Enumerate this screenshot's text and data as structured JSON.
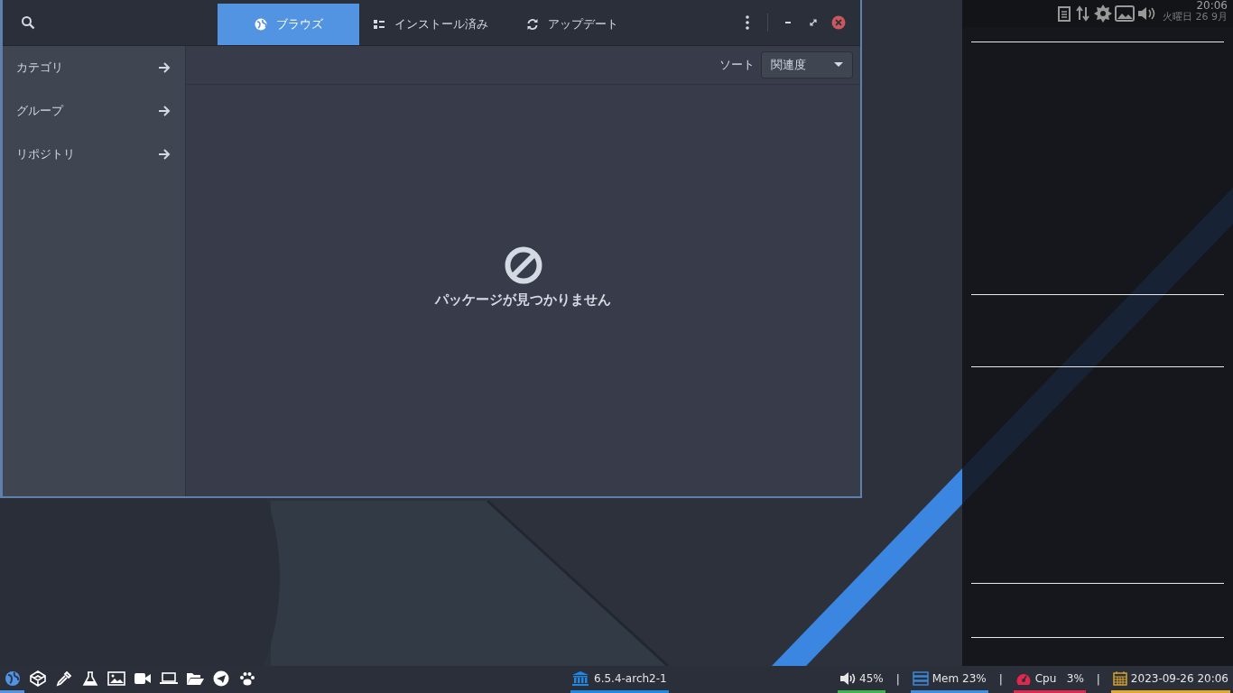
{
  "window": {
    "tabs": [
      {
        "label": "ブラウズ",
        "kind": "globe",
        "selected": true
      },
      {
        "label": "インストール済み",
        "kind": "list",
        "selected": false
      },
      {
        "label": "アップデート",
        "kind": "refresh",
        "selected": false
      }
    ],
    "sidebar": {
      "items": [
        {
          "label": "カテゴリ"
        },
        {
          "label": "グループ"
        },
        {
          "label": "リポジトリ"
        }
      ]
    },
    "sort": {
      "label": "ソート",
      "value": "関連度"
    },
    "empty_state": {
      "message": "パッケージが見つかりません"
    }
  },
  "side_panel": {
    "clock": {
      "time": "20:06",
      "date": "火曜日 26 9月"
    }
  },
  "taskbar": {
    "launchers": [
      {
        "kind": "globe",
        "selected": true
      },
      {
        "kind": "cube",
        "selected": false
      },
      {
        "kind": "dropper",
        "selected": false
      },
      {
        "kind": "flask",
        "selected": false
      },
      {
        "kind": "image",
        "selected": false
      },
      {
        "kind": "camera",
        "selected": false
      },
      {
        "kind": "laptop",
        "selected": false
      },
      {
        "kind": "folder",
        "selected": false
      },
      {
        "kind": "send",
        "selected": false
      },
      {
        "kind": "paw",
        "selected": false
      }
    ],
    "kernel": {
      "text": "6.5.4-arch2-1",
      "color": "#1e88e5"
    },
    "indicators": [
      {
        "kind": "volume",
        "text": "45%",
        "color": "#3fb34f"
      },
      {
        "kind": "memory",
        "divider": "|",
        "text": "Mem 23%",
        "color": "#3d8ee0"
      },
      {
        "kind": "cpu",
        "divider": "|",
        "text": "Cpu   3%",
        "color": "#e0284f"
      },
      {
        "kind": "calendar",
        "divider": "|",
        "text": "2023-09-26 20:06",
        "color": "#e0a92b"
      }
    ]
  }
}
